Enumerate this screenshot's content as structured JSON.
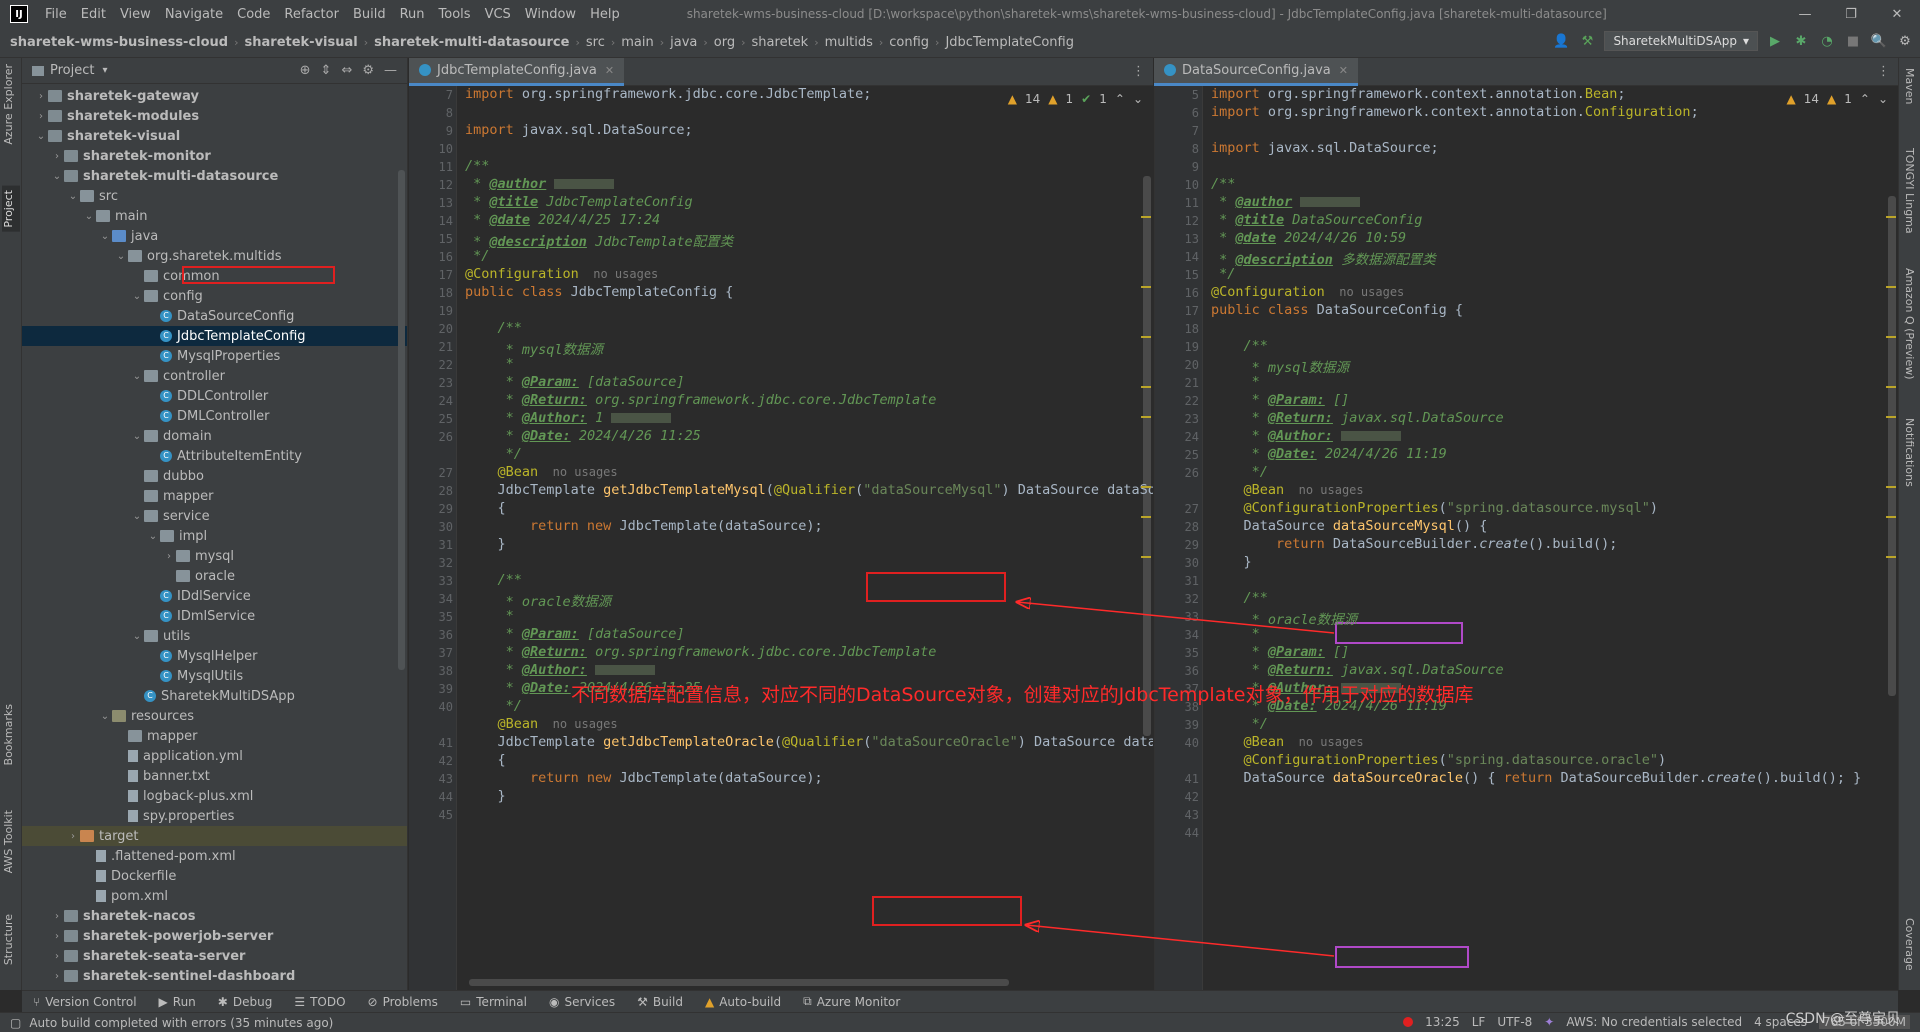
{
  "menubar": {
    "items": [
      "File",
      "Edit",
      "View",
      "Navigate",
      "Code",
      "Refactor",
      "Build",
      "Run",
      "Tools",
      "VCS",
      "Window",
      "Help"
    ],
    "title": "sharetek-wms-business-cloud [D:\\workspace\\python\\sharetek-wms\\sharetek-wms-business-cloud] - JdbcTemplateConfig.java [sharetek-multi-datasource]"
  },
  "breadcrumbs": [
    "sharetek-wms-business-cloud",
    "sharetek-visual",
    "sharetek-multi-datasource",
    "src",
    "main",
    "java",
    "org",
    "sharetek",
    "multids",
    "config",
    "JdbcTemplateConfig"
  ],
  "run_config": "SharetekMultiDSApp",
  "left_tabs": {
    "azure": "Azure Explorer",
    "project": "Project",
    "bookmarks": "Bookmarks",
    "aws": "AWS Toolkit",
    "structure": "Structure"
  },
  "right_tabs": {
    "maven": "Maven",
    "tongyi": "TONGYI Lingma",
    "amazonq": "Amazon Q (Preview)",
    "notifications": "Notifications",
    "coverage": "Coverage"
  },
  "project_panel": {
    "title": "Project",
    "tree": [
      {
        "label": "sharetek-gateway",
        "depth": 0,
        "arrow": "›",
        "icon": "folder mod",
        "bold": true
      },
      {
        "label": "sharetek-modules",
        "depth": 0,
        "arrow": "›",
        "icon": "folder mod",
        "bold": true
      },
      {
        "label": "sharetek-visual",
        "depth": 0,
        "arrow": "⌄",
        "icon": "folder mod",
        "bold": true
      },
      {
        "label": "sharetek-monitor",
        "depth": 1,
        "arrow": "›",
        "icon": "folder mod",
        "bold": true
      },
      {
        "label": "sharetek-multi-datasource",
        "depth": 1,
        "arrow": "⌄",
        "icon": "folder mod",
        "bold": true
      },
      {
        "label": "src",
        "depth": 2,
        "arrow": "⌄",
        "icon": "folder"
      },
      {
        "label": "main",
        "depth": 3,
        "arrow": "⌄",
        "icon": "folder"
      },
      {
        "label": "java",
        "depth": 4,
        "arrow": "⌄",
        "icon": "folder src"
      },
      {
        "label": "org.sharetek.multids",
        "depth": 5,
        "arrow": "⌄",
        "icon": "folder"
      },
      {
        "label": "common",
        "depth": 6,
        "arrow": "",
        "icon": "folder"
      },
      {
        "label": "config",
        "depth": 6,
        "arrow": "⌄",
        "icon": "folder"
      },
      {
        "label": "DataSourceConfig",
        "depth": 7,
        "arrow": "",
        "icon": "cls"
      },
      {
        "label": "JdbcTemplateConfig",
        "depth": 7,
        "arrow": "",
        "icon": "cls",
        "selected": true
      },
      {
        "label": "MysqlProperties",
        "depth": 7,
        "arrow": "",
        "icon": "cls"
      },
      {
        "label": "controller",
        "depth": 6,
        "arrow": "⌄",
        "icon": "folder"
      },
      {
        "label": "DDLController",
        "depth": 7,
        "arrow": "",
        "icon": "cls"
      },
      {
        "label": "DMLController",
        "depth": 7,
        "arrow": "",
        "icon": "cls"
      },
      {
        "label": "domain",
        "depth": 6,
        "arrow": "⌄",
        "icon": "folder"
      },
      {
        "label": "AttributeItemEntity",
        "depth": 7,
        "arrow": "",
        "icon": "cls"
      },
      {
        "label": "dubbo",
        "depth": 6,
        "arrow": "",
        "icon": "folder"
      },
      {
        "label": "mapper",
        "depth": 6,
        "arrow": "",
        "icon": "folder"
      },
      {
        "label": "service",
        "depth": 6,
        "arrow": "⌄",
        "icon": "folder"
      },
      {
        "label": "impl",
        "depth": 7,
        "arrow": "⌄",
        "icon": "folder"
      },
      {
        "label": "mysql",
        "depth": 8,
        "arrow": "›",
        "icon": "folder"
      },
      {
        "label": "oracle",
        "depth": 8,
        "arrow": "",
        "icon": "folder"
      },
      {
        "label": "IDdlService",
        "depth": 7,
        "arrow": "",
        "icon": "cls"
      },
      {
        "label": "IDmlService",
        "depth": 7,
        "arrow": "",
        "icon": "cls"
      },
      {
        "label": "utils",
        "depth": 6,
        "arrow": "⌄",
        "icon": "folder"
      },
      {
        "label": "MysqlHelper",
        "depth": 7,
        "arrow": "",
        "icon": "cls"
      },
      {
        "label": "MysqlUtils",
        "depth": 7,
        "arrow": "",
        "icon": "cls"
      },
      {
        "label": "SharetekMultiDSApp",
        "depth": 6,
        "arrow": "",
        "icon": "cls"
      },
      {
        "label": "resources",
        "depth": 4,
        "arrow": "⌄",
        "icon": "folder res"
      },
      {
        "label": "mapper",
        "depth": 5,
        "arrow": "",
        "icon": "folder"
      },
      {
        "label": "application.yml",
        "depth": 5,
        "arrow": "",
        "icon": "file"
      },
      {
        "label": "banner.txt",
        "depth": 5,
        "arrow": "",
        "icon": "file"
      },
      {
        "label": "logback-plus.xml",
        "depth": 5,
        "arrow": "",
        "icon": "file"
      },
      {
        "label": "spy.properties",
        "depth": 5,
        "arrow": "",
        "icon": "file"
      },
      {
        "label": "target",
        "depth": 2,
        "arrow": "›",
        "icon": "folder orange",
        "target": true
      },
      {
        "label": ".flattened-pom.xml",
        "depth": 3,
        "arrow": "",
        "icon": "file"
      },
      {
        "label": "Dockerfile",
        "depth": 3,
        "arrow": "",
        "icon": "file"
      },
      {
        "label": "pom.xml",
        "depth": 3,
        "arrow": "",
        "icon": "file"
      },
      {
        "label": "sharetek-nacos",
        "depth": 1,
        "arrow": "›",
        "icon": "folder mod",
        "bold": true
      },
      {
        "label": "sharetek-powerjob-server",
        "depth": 1,
        "arrow": "›",
        "icon": "folder mod",
        "bold": true
      },
      {
        "label": "sharetek-seata-server",
        "depth": 1,
        "arrow": "›",
        "icon": "folder mod",
        "bold": true
      },
      {
        "label": "sharetek-sentinel-dashboard",
        "depth": 1,
        "arrow": "›",
        "icon": "folder mod",
        "bold": true
      }
    ]
  },
  "left_editor": {
    "tab": "JdbcTemplateConfig.java",
    "indicators": {
      "warnings": "14",
      "weak": "1",
      "ok": "1"
    },
    "line_numbers": [
      "7",
      "8",
      "9",
      "10",
      "11",
      "12",
      "13",
      "14",
      "15",
      "16",
      "17",
      "18",
      "19",
      "20",
      "21",
      "22",
      "23",
      "24",
      "25",
      "26",
      "",
      "27",
      "28",
      "29",
      "30",
      "31",
      "32",
      "33",
      "34",
      "35",
      "36",
      "37",
      "38",
      "39",
      "40",
      "",
      "41",
      "42",
      "43",
      "44",
      "45"
    ],
    "lines": [
      [
        [
          "kw",
          "import "
        ],
        [
          "",
          "org.springframework.jdbc.core.JdbcTemplate;"
        ]
      ],
      [],
      [
        [
          "kw",
          "import "
        ],
        [
          "",
          "javax.sql.DataSource;"
        ]
      ],
      [],
      [
        [
          "cm",
          "/**"
        ]
      ],
      [
        [
          "cm",
          " * "
        ],
        [
          "tag",
          "@author"
        ],
        [
          "blur",
          ""
        ]
      ],
      [
        [
          "cm",
          " * "
        ],
        [
          "tag",
          "@title"
        ],
        [
          "cm",
          " JdbcTemplateConfig"
        ]
      ],
      [
        [
          "cm",
          " * "
        ],
        [
          "tag",
          "@date"
        ],
        [
          "cm",
          " 2024/4/25 17:24"
        ]
      ],
      [
        [
          "cm",
          " * "
        ],
        [
          "tag",
          "@description"
        ],
        [
          "cm",
          " JdbcTemplate配置类"
        ]
      ],
      [
        [
          "cm",
          " */"
        ]
      ],
      [
        [
          "ann",
          "@Configuration"
        ],
        [
          "mt",
          "  no usages"
        ]
      ],
      [
        [
          "kw",
          "public class "
        ],
        [
          "",
          "JdbcTemplateConfig {"
        ]
      ],
      [],
      [
        [
          "cm",
          "    /**"
        ]
      ],
      [
        [
          "cm",
          "     * mysql数据源"
        ]
      ],
      [
        [
          "cm",
          "     *"
        ]
      ],
      [
        [
          "cm",
          "     * "
        ],
        [
          "tag",
          "@Param:"
        ],
        [
          "cm",
          " [dataSource]"
        ]
      ],
      [
        [
          "cm",
          "     * "
        ],
        [
          "tag",
          "@Return:"
        ],
        [
          "cm",
          " org.springframework.jdbc.core.JdbcTemplate"
        ]
      ],
      [
        [
          "cm",
          "     * "
        ],
        [
          "tag",
          "@Author:"
        ],
        [
          "cm",
          " 1"
        ],
        [
          "blur",
          ""
        ]
      ],
      [
        [
          "cm",
          "     * "
        ],
        [
          "tag",
          "@Date:"
        ],
        [
          "cm",
          " 2024/4/26 11:25"
        ]
      ],
      [
        [
          "cm",
          "     */"
        ]
      ],
      [
        [
          "ann",
          "    @Bean"
        ],
        [
          "mt",
          "  no usages"
        ]
      ],
      [
        [
          "",
          "    JdbcTemplate "
        ],
        [
          "fn",
          "getJdbcTemplateMysql"
        ],
        [
          "",
          "("
        ],
        [
          "ann",
          "@Qualifier"
        ],
        [
          "",
          "("
        ],
        [
          "str",
          "\"dataSourceMysql\""
        ],
        [
          "",
          ") DataSource dataSo"
        ]
      ],
      [
        [
          "",
          "    {"
        ]
      ],
      [
        [
          "kw",
          "        return new "
        ],
        [
          "",
          "JdbcTemplate(dataSource);"
        ]
      ],
      [
        [
          "",
          "    }"
        ]
      ],
      [],
      [
        [
          "cm",
          "    /**"
        ]
      ],
      [
        [
          "cm",
          "     * oracle数据源"
        ]
      ],
      [
        [
          "cm",
          "     *"
        ]
      ],
      [
        [
          "cm",
          "     * "
        ],
        [
          "tag",
          "@Param:"
        ],
        [
          "cm",
          " [dataSource]"
        ]
      ],
      [
        [
          "cm",
          "     * "
        ],
        [
          "tag",
          "@Return:"
        ],
        [
          "cm",
          " org.springframework.jdbc.core.JdbcTemplate"
        ]
      ],
      [
        [
          "cm",
          "     * "
        ],
        [
          "tag",
          "@Author:"
        ],
        [
          "blur",
          ""
        ]
      ],
      [
        [
          "cm",
          "     * "
        ],
        [
          "tag",
          "@Date:"
        ],
        [
          "cm",
          " 2024/4/26 11:25"
        ]
      ],
      [
        [
          "cm",
          "     */"
        ]
      ],
      [
        [
          "ann",
          "    @Bean"
        ],
        [
          "mt",
          "  no usages"
        ]
      ],
      [
        [
          "",
          "    JdbcTemplate "
        ],
        [
          "fn",
          "getJdbcTemplateOracle"
        ],
        [
          "",
          "("
        ],
        [
          "ann",
          "@Qualifier"
        ],
        [
          "",
          "("
        ],
        [
          "str",
          "\"dataSourceOracle\""
        ],
        [
          "",
          ") DataSource data"
        ]
      ],
      [
        [
          "",
          "    {"
        ]
      ],
      [
        [
          "kw",
          "        return new "
        ],
        [
          "",
          "JdbcTemplate(dataSource);"
        ]
      ],
      [
        [
          "",
          "    }"
        ]
      ]
    ]
  },
  "right_editor": {
    "tab": "DataSourceConfig.java",
    "indicators": {
      "warnings": "14",
      "weak": "1"
    },
    "line_numbers": [
      "5",
      "6",
      "7",
      "8",
      "9",
      "10",
      "11",
      "12",
      "13",
      "14",
      "15",
      "16",
      "17",
      "18",
      "19",
      "20",
      "21",
      "22",
      "23",
      "24",
      "25",
      "26",
      "",
      "27",
      "28",
      "29",
      "30",
      "31",
      "32",
      "33",
      "34",
      "35",
      "36",
      "37",
      "38",
      "39",
      "40",
      "",
      "41",
      "42",
      "43",
      "44"
    ],
    "lines": [
      [
        [
          "kw",
          "import "
        ],
        [
          "",
          "org.springframework.context.annotation."
        ],
        [
          "ann",
          "Bean"
        ],
        [
          "",
          ";"
        ]
      ],
      [
        [
          "kw",
          "import "
        ],
        [
          "",
          "org.springframework.context.annotation."
        ],
        [
          "ann",
          "Configuration"
        ],
        [
          "",
          ";"
        ]
      ],
      [],
      [
        [
          "kw",
          "import "
        ],
        [
          "",
          "javax.sql.DataSource;"
        ]
      ],
      [],
      [
        [
          "cm",
          "/**"
        ]
      ],
      [
        [
          "cm",
          " * "
        ],
        [
          "tag",
          "@author"
        ],
        [
          "blur",
          ""
        ]
      ],
      [
        [
          "cm",
          " * "
        ],
        [
          "tag",
          "@title"
        ],
        [
          "cm",
          " DataSourceConfig"
        ]
      ],
      [
        [
          "cm",
          " * "
        ],
        [
          "tag",
          "@date"
        ],
        [
          "cm",
          " 2024/4/26 10:59"
        ]
      ],
      [
        [
          "cm",
          " * "
        ],
        [
          "tag",
          "@description"
        ],
        [
          "cm",
          " 多数据源配置类"
        ]
      ],
      [
        [
          "cm",
          " */"
        ]
      ],
      [
        [
          "ann",
          "@Configuration"
        ],
        [
          "mt",
          "  no usages"
        ]
      ],
      [
        [
          "kw",
          "public class "
        ],
        [
          "",
          "DataSourceConfig {"
        ]
      ],
      [],
      [
        [
          "cm",
          "    /**"
        ]
      ],
      [
        [
          "cm",
          "     * mysql数据源"
        ]
      ],
      [
        [
          "cm",
          "     *"
        ]
      ],
      [
        [
          "cm",
          "     * "
        ],
        [
          "tag",
          "@Param:"
        ],
        [
          "cm",
          " []"
        ]
      ],
      [
        [
          "cm",
          "     * "
        ],
        [
          "tag",
          "@Return:"
        ],
        [
          "cm",
          " javax.sql.DataSource"
        ]
      ],
      [
        [
          "cm",
          "     * "
        ],
        [
          "tag",
          "@Author:"
        ],
        [
          "blur",
          ""
        ]
      ],
      [
        [
          "cm",
          "     * "
        ],
        [
          "tag",
          "@Date:"
        ],
        [
          "cm",
          " 2024/4/26 11:19"
        ]
      ],
      [
        [
          "cm",
          "     */"
        ]
      ],
      [
        [
          "ann",
          "    @Bean"
        ],
        [
          "mt",
          "  no usages"
        ]
      ],
      [
        [
          "ann",
          "    @ConfigurationProperties"
        ],
        [
          "",
          "("
        ],
        [
          "str",
          "\"spring.datasource.mysql\""
        ],
        [
          "",
          ")"
        ]
      ],
      [
        [
          "",
          "    DataSource "
        ],
        [
          "fn",
          "dataSourceMysql"
        ],
        [
          "",
          "() {"
        ]
      ],
      [
        [
          "kw",
          "        return "
        ],
        [
          "",
          "DataSourceBuilder."
        ],
        [
          "it",
          "create"
        ],
        [
          "",
          "().build();"
        ]
      ],
      [
        [
          "",
          "    }"
        ]
      ],
      [],
      [
        [
          "cm",
          "    /**"
        ]
      ],
      [
        [
          "cm",
          "     * oracle数据源"
        ]
      ],
      [
        [
          "cm",
          "     *"
        ]
      ],
      [
        [
          "cm",
          "     * "
        ],
        [
          "tag",
          "@Param:"
        ],
        [
          "cm",
          " []"
        ]
      ],
      [
        [
          "cm",
          "     * "
        ],
        [
          "tag",
          "@Return:"
        ],
        [
          "cm",
          " javax.sql.DataSource"
        ]
      ],
      [
        [
          "cm",
          "     * "
        ],
        [
          "tag",
          "@Author:"
        ],
        [
          "blur",
          ""
        ]
      ],
      [
        [
          "cm",
          "     * "
        ],
        [
          "tag",
          "@Date:"
        ],
        [
          "cm",
          " 2024/4/26 11:19"
        ]
      ],
      [
        [
          "cm",
          "     */"
        ]
      ],
      [
        [
          "ann",
          "    @Bean"
        ],
        [
          "mt",
          "  no usages"
        ]
      ],
      [
        [
          "ann",
          "    @ConfigurationProperties"
        ],
        [
          "",
          "("
        ],
        [
          "str",
          "\"spring.datasource.oracle\""
        ],
        [
          "",
          ")"
        ]
      ],
      [
        [
          "",
          "    DataSource "
        ],
        [
          "fn",
          "dataSourceOracle"
        ],
        [
          "",
          "() { "
        ],
        [
          "kw",
          "return "
        ],
        [
          "",
          "DataSourceBuilder."
        ],
        [
          "it",
          "create"
        ],
        [
          "",
          "().build(); }"
        ]
      ],
      []
    ]
  },
  "annotation_text": "不同数据库配置信息，对应不同的DataSource对象，创建对应的JdbcTemplate对象，作用于对应的数据库",
  "tool_windows": [
    "Version Control",
    "Run",
    "Debug",
    "TODO",
    "Problems",
    "Terminal",
    "Services",
    "Build",
    "Auto-build",
    "Azure Monitor"
  ],
  "status": {
    "message": "Auto build completed with errors (35 minutes ago)",
    "position": "13:25",
    "line_sep": "LF",
    "encoding": "UTF-8",
    "aws": "AWS: No credentials selected",
    "indent": "4 spaces",
    "memory": "765 of 3500M"
  },
  "watermark": "CSDN @至尊宝贝",
  "colors": {
    "red_annotation": "#ff2a2a",
    "purple_box": "#b049c8",
    "accent": "#4a88c7"
  }
}
